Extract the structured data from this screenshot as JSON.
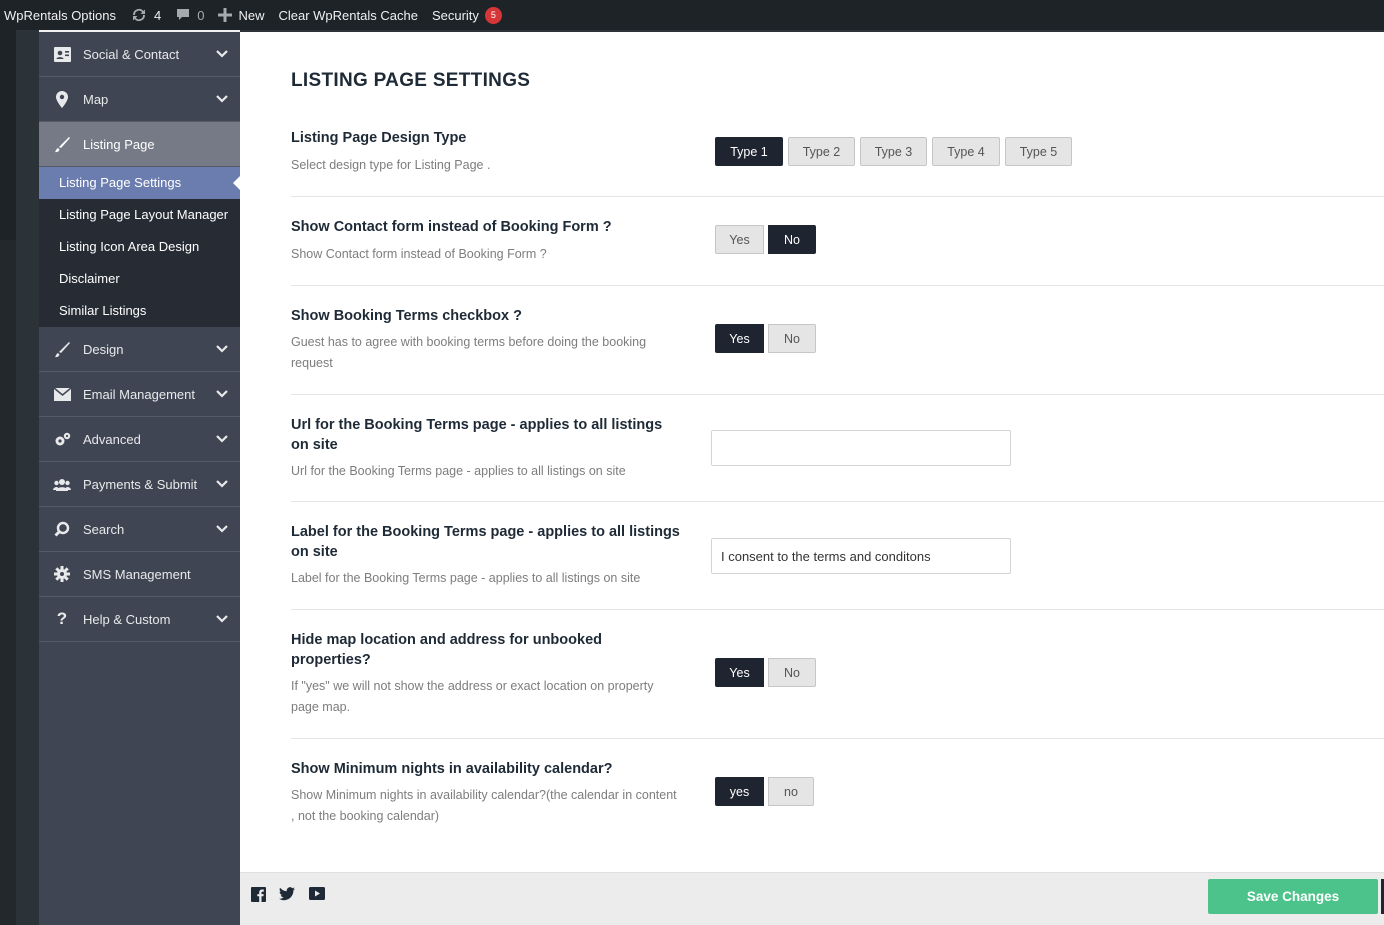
{
  "adminbar": {
    "site_name": "WpRentals Options",
    "updates_count": "4",
    "comments_count": "0",
    "new_label": "New",
    "clear_cache_label": "Clear WpRentals Cache",
    "security_label": "Security",
    "security_count": "5"
  },
  "sidebar": {
    "items": [
      {
        "label": "Social & Contact",
        "icon": "contact-card-icon"
      },
      {
        "label": "Map",
        "icon": "map-pin-icon"
      },
      {
        "label": "Listing Page",
        "icon": "brush-icon"
      },
      {
        "label": "Design",
        "icon": "brush-icon"
      },
      {
        "label": "Email Management",
        "icon": "envelope-icon"
      },
      {
        "label": "Advanced",
        "icon": "gears-icon"
      },
      {
        "label": "Payments & Submit",
        "icon": "users-icon"
      },
      {
        "label": "Search",
        "icon": "search-icon"
      },
      {
        "label": "SMS Management",
        "icon": "gear-icon"
      },
      {
        "label": "Help & Custom",
        "icon": "question-icon"
      }
    ],
    "subitems": [
      "Listing Page Settings",
      "Listing Page Layout Manager",
      "Listing Icon Area Design",
      "Disclaimer",
      "Similar Listings"
    ]
  },
  "main": {
    "title": "LISTING PAGE SETTINGS",
    "design_type": {
      "label": "Listing Page Design Type",
      "desc": "Select design type for Listing Page .",
      "options": [
        "Type 1",
        "Type 2",
        "Type 3",
        "Type 4",
        "Type 5"
      ],
      "selected": "Type 1"
    },
    "contact_form": {
      "label": "Show Contact form instead of Booking Form ?",
      "desc": "Show Contact form instead of Booking Form ?",
      "yes": "Yes",
      "no": "No",
      "selected": "No"
    },
    "booking_terms": {
      "label": "Show Booking Terms checkbox ?",
      "desc": "Guest has to agree with booking terms before doing the booking request",
      "yes": "Yes",
      "no": "No",
      "selected": "Yes"
    },
    "terms_url": {
      "label": "Url for the Booking Terms page - applies to all listings on site",
      "desc": "Url for the Booking Terms page - applies to all listings on site",
      "value": ""
    },
    "terms_label": {
      "label": "Label for the Booking Terms page - applies to all listings on site",
      "desc": "Label for the Booking Terms page - applies to all listings on site",
      "value": "I consent to the terms and conditons"
    },
    "hide_map": {
      "label": "Hide map location and address for unbooked properties?",
      "desc": "If \"yes\" we will not show the address or exact location on property page map.",
      "yes": "Yes",
      "no": "No",
      "selected": "Yes"
    },
    "min_nights": {
      "label": "Show Minimum nights in availability calendar?",
      "desc": "Show Minimum nights in availability calendar?(the calendar in content , not the booking calendar)",
      "yes": "yes",
      "no": "no",
      "selected": "yes"
    }
  },
  "footer": {
    "save_label": "Save Changes",
    "social": [
      "facebook-icon",
      "twitter-icon",
      "youtube-icon"
    ]
  }
}
